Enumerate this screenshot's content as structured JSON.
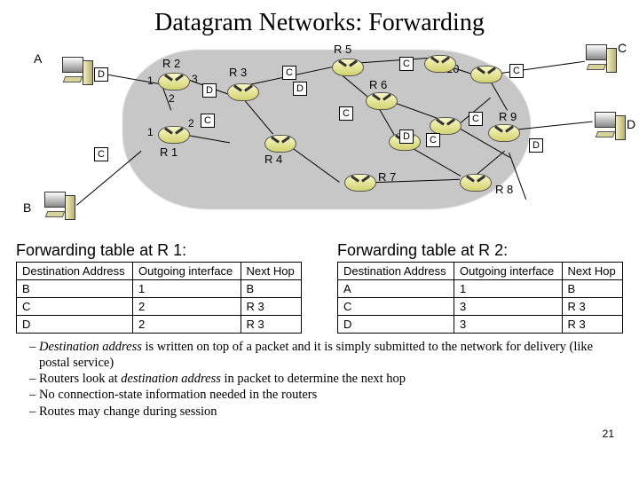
{
  "title": "Datagram Networks: Forwarding",
  "hosts": {
    "A": "A",
    "B": "B",
    "C": "C",
    "D": "D"
  },
  "routers": {
    "R1": "R 1",
    "R2": "R 2",
    "R3": "R 3",
    "R4": "R 4",
    "R5": "R 5",
    "R6": "R 6",
    "R7": "R 7",
    "R8": "R 8",
    "R9": "R 9",
    "R10": "R 10"
  },
  "ports": {
    "p1": "1",
    "p2": "2",
    "p3": "3"
  },
  "packets": {
    "C": "C",
    "D": "D"
  },
  "table1": {
    "title": "Forwarding table at R 1:",
    "headers": {
      "dest": "Destination Address",
      "iface": "Outgoing interface",
      "next": "Next Hop"
    },
    "rows": [
      {
        "dest": "B",
        "iface": "1",
        "next": "B"
      },
      {
        "dest": "C",
        "iface": "2",
        "next": "R 3"
      },
      {
        "dest": "D",
        "iface": "2",
        "next": "R 3"
      }
    ]
  },
  "table2": {
    "title": "Forwarding table at R 2:",
    "headers": {
      "dest": "Destination Address",
      "iface": "Outgoing interface",
      "next": "Next Hop"
    },
    "rows": [
      {
        "dest": "A",
        "iface": "1",
        "next": "B"
      },
      {
        "dest": "C",
        "iface": "3",
        "next": "R 3"
      },
      {
        "dest": "D",
        "iface": "3",
        "next": "R 3"
      }
    ]
  },
  "bullets": {
    "b1a": "Destination address",
    "b1b": " is written on top of a packet and it is simply submitted to the network for delivery (like postal service)",
    "b2a": "Routers look at ",
    "b2b": "destination address",
    "b2c": " in packet to determine the next hop",
    "b3": "No connection-state information needed in the routers",
    "b4": "Routes may change during session"
  },
  "pagenum": "21"
}
